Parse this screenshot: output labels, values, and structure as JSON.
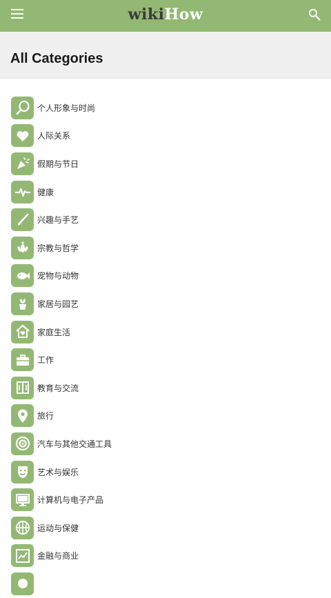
{
  "header": {
    "logo_wiki": "wiki",
    "logo_how": "How"
  },
  "page": {
    "title": "All Categories"
  },
  "categories": [
    {
      "label": "个人形象与时尚",
      "icon": "mirror-icon"
    },
    {
      "label": "人际关系",
      "icon": "heart-icon"
    },
    {
      "label": "假期与节日",
      "icon": "party-icon"
    },
    {
      "label": "健康",
      "icon": "heartbeat-icon"
    },
    {
      "label": "兴趣与手艺",
      "icon": "paintbrush-icon"
    },
    {
      "label": "宗教与哲学",
      "icon": "lotus-icon"
    },
    {
      "label": "宠物与动物",
      "icon": "fish-icon"
    },
    {
      "label": "家居与园艺",
      "icon": "plant-pot-icon"
    },
    {
      "label": "家庭生活",
      "icon": "home-heart-icon"
    },
    {
      "label": "工作",
      "icon": "briefcase-icon"
    },
    {
      "label": "教育与交流",
      "icon": "book-icon"
    },
    {
      "label": "旅行",
      "icon": "map-pin-icon"
    },
    {
      "label": "汽车与其他交通工具",
      "icon": "steering-wheel-icon"
    },
    {
      "label": "艺术与娱乐",
      "icon": "theater-mask-icon"
    },
    {
      "label": "计算机与电子产品",
      "icon": "monitor-icon"
    },
    {
      "label": "运动与保健",
      "icon": "basketball-icon"
    },
    {
      "label": "金融与商业",
      "icon": "chart-icon"
    },
    {
      "label": "",
      "icon": "category-icon"
    }
  ],
  "colors": {
    "brand_green": "#93b874",
    "subheader_bg": "#f0f0f0"
  }
}
